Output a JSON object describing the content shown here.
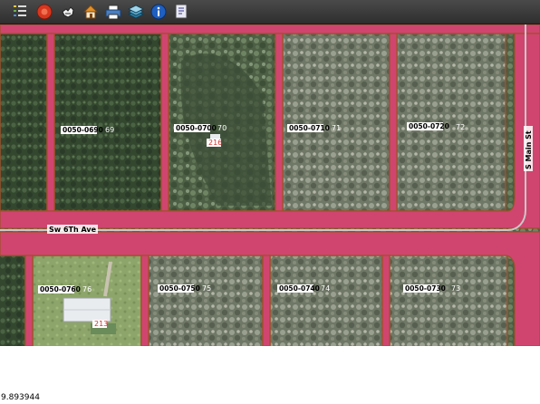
{
  "toolbar": {
    "tools": [
      {
        "name": "layers-list-icon"
      },
      {
        "name": "stop-icon"
      },
      {
        "name": "pan-hand-icon"
      },
      {
        "name": "home-icon"
      },
      {
        "name": "print-icon"
      },
      {
        "name": "layers-stack-icon"
      },
      {
        "name": "info-icon"
      },
      {
        "name": "identify-icon"
      }
    ]
  },
  "map": {
    "parcels": [
      {
        "id": "0050-0690",
        "num": "69"
      },
      {
        "id": "0050-0700",
        "num": "70"
      },
      {
        "id": "0050-0710",
        "num": "71"
      },
      {
        "id": "0050-0720",
        "num": "72"
      },
      {
        "id": "0050-0760",
        "num": "76"
      },
      {
        "id": "0050-0750",
        "num": "75"
      },
      {
        "id": "0050-0740",
        "num": "74"
      },
      {
        "id": "0050-0730",
        "num": "73"
      }
    ],
    "addresses": [
      {
        "value": "216"
      },
      {
        "value": "213"
      }
    ],
    "streets": {
      "horizontal": "Sw 6Th Ave",
      "vertical": "S Main St"
    },
    "colors": {
      "road": "#d0456f",
      "boundary": "#a0502a",
      "vegetation": "#5b6d50"
    }
  },
  "status": {
    "coordinate": "9.893944"
  }
}
